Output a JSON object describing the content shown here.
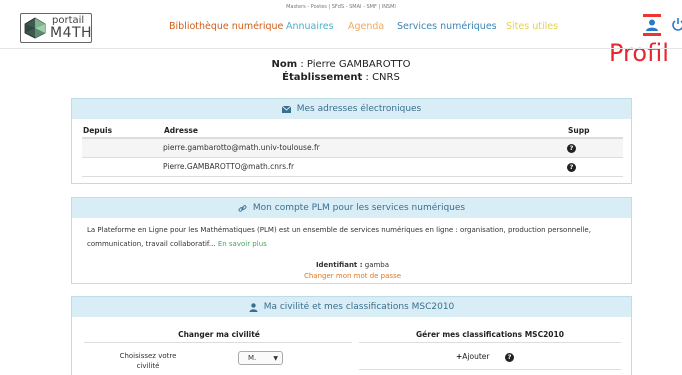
{
  "top_note": "Masters - Postes | SFdS - SMAI - SMF | INSMI",
  "logo": {
    "line1": "portail",
    "line2": "M4TH"
  },
  "nav": {
    "items": [
      {
        "label": "Bibliothèque numérique",
        "color": "#d05d16"
      },
      {
        "label": "Annuaires",
        "color": "#4ab0c7"
      },
      {
        "label": "Agenda",
        "color": "#f0a860"
      },
      {
        "label": "Services numériques",
        "color": "#3a86b5"
      },
      {
        "label": "Sites utiles",
        "color": "#e1d34a"
      }
    ]
  },
  "header": {
    "user_icon": "user-icon",
    "power_icon": "power-icon",
    "profil_label": "Profil"
  },
  "identity": {
    "name_label": "Nom",
    "name_value": "Pierre GAMBAROTTO",
    "etab_label": "Établissement",
    "etab_value": "CNRS"
  },
  "emails_panel": {
    "icon": "envelope-icon",
    "title": "Mes adresses électroniques",
    "columns": [
      "Depuis",
      "Adresse",
      "Supp"
    ],
    "rows": [
      {
        "since": "",
        "address": "pierre.gambarotto@math.univ-toulouse.fr"
      },
      {
        "since": "",
        "address": "Pierre.GAMBAROTTO@math.cnrs.fr"
      }
    ]
  },
  "plm_panel": {
    "icon": "link-icon",
    "title": "Mon compte PLM pour les services numériques",
    "description": "La Plateforme en Ligne pour les Mathématiques (PLM) est un ensemble de services numériques en ligne : organisation, production personnelle, communication, travail collaboratif...",
    "more_link": "En savoir plus",
    "identifiant_label": "Identifiant :",
    "identifiant_value": "gamba",
    "change_password": "Changer mon mot de passe"
  },
  "civility_panel": {
    "icon": "user-icon",
    "title": "Ma civilité et mes classifications MSC2010",
    "left_title": "Changer ma civilité",
    "right_title": "Gérer mes classifications MSC2010",
    "civility_label": "Choisissez votre civilité",
    "civility_value": "M.",
    "add_label": "Ajouter"
  },
  "colors": {
    "panel_heading_bg": "#d9edf7",
    "panel_heading_text": "#3a6f8c",
    "profil_red": "#e8262f",
    "link_green": "#4aa55b",
    "change_pw_orange": "#e07a24"
  }
}
